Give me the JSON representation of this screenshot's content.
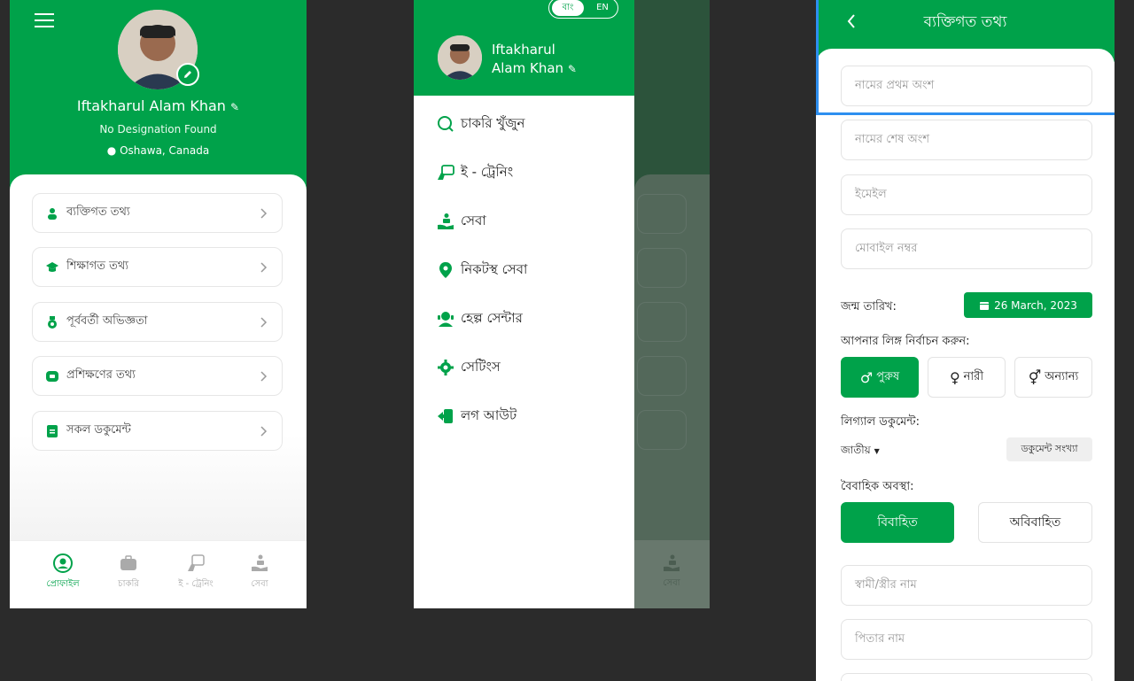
{
  "profile": {
    "name": "Iftakharul Alam Khan",
    "designation": "No Designation Found",
    "location": "Oshawa, Canada",
    "cards": [
      {
        "label": "ব্যক্তিগত তথ্য",
        "icon": "person-icon"
      },
      {
        "label": "শিক্ষাগত তথ্য",
        "icon": "graduation-cap-icon"
      },
      {
        "label": "পূর্ববর্তী অভিজ্ঞতা",
        "icon": "medal-icon"
      },
      {
        "label": "প্রশিক্ষণের তথ্য",
        "icon": "certificate-icon"
      },
      {
        "label": "সকল ডকুমেন্ট",
        "icon": "document-icon"
      }
    ],
    "bottom_nav": [
      {
        "label": "প্রোফাইল",
        "icon": "profile-icon",
        "active": true
      },
      {
        "label": "চাকরি",
        "icon": "briefcase-icon",
        "active": false
      },
      {
        "label": "ই - ট্রেনিং",
        "icon": "e-training-icon",
        "active": false
      },
      {
        "label": "সেবা",
        "icon": "service-hand-icon",
        "active": false
      }
    ]
  },
  "drawer": {
    "lang_bn": "বাং",
    "lang_en": "EN",
    "name_line1": "Iftakharul",
    "name_line2": "Alam Khan",
    "items": [
      {
        "label": "চাকরি খুঁজুন",
        "icon": "search-icon"
      },
      {
        "label": "ই - ট্রেনিং",
        "icon": "e-training-icon"
      },
      {
        "label": "সেবা",
        "icon": "service-hand-icon"
      },
      {
        "label": "নিকটস্থ সেবা",
        "icon": "location-pin-icon"
      },
      {
        "label": "হেল্প সেন্টার",
        "icon": "help-center-icon"
      },
      {
        "label": "সেটিংস",
        "icon": "gear-icon"
      },
      {
        "label": "লগ আউট",
        "icon": "logout-icon"
      }
    ],
    "behind_nav_label": "সেবা"
  },
  "personal": {
    "title": "ব্যক্তিগত তথ্য",
    "first_name_placeholder": "নামের প্রথম অংশ",
    "last_name_placeholder": "নামের শেষ অংশ",
    "email_placeholder": "ইমেইল",
    "mobile_placeholder": "মোবাইল নম্বর",
    "dob_label": "জন্ম তারিখ:",
    "dob_value": "26 March, 2023",
    "gender_label": "আপনার লিঙ্গ নির্বাচন করুন:",
    "gender_male": "পুরুষ",
    "gender_female": "নারী",
    "gender_other": "অন্যান্য",
    "legal_doc_label": "লিগ্যাল ডকুমেন্ট:",
    "doc_type": "জাতীয়",
    "doc_number": "ডকুমেন্ট সংখ্যা",
    "marital_label": "বৈবাহিক অবস্থা:",
    "married": "বিবাহিত",
    "unmarried": "অবিবাহিত",
    "spouse_placeholder": "স্বামী/স্ত্রীর নাম",
    "father_placeholder": "পিতার নাম"
  },
  "colors": {
    "brand_green": "#00a24a",
    "selection_blue": "#2d8ff0"
  }
}
